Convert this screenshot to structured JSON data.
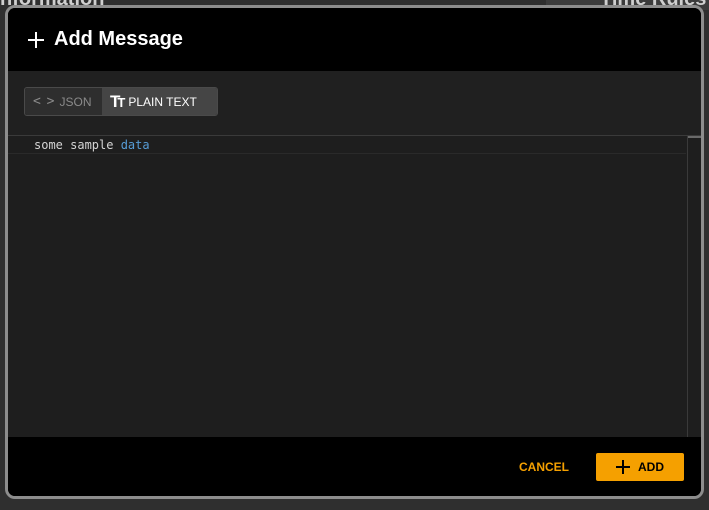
{
  "background": {
    "left_heading": "nformation",
    "right_heading": "Time Rules"
  },
  "dialog": {
    "title": "Add Message",
    "format_toggle": {
      "json_label": "JSON",
      "plain_text_label": "PLAIN TEXT",
      "selected": "PLAIN TEXT"
    },
    "editor": {
      "text_plain": "some sample ",
      "text_keyword": "data"
    },
    "footer": {
      "cancel_label": "CANCEL",
      "add_label": "ADD"
    }
  },
  "colors": {
    "accent": "#f5a000",
    "keyword": "#569cd6"
  },
  "icons": {
    "title_icon": "plus-icon",
    "json_icon": "code-icon",
    "plain_text_icon": "text-format-icon",
    "add_icon": "plus-icon"
  }
}
